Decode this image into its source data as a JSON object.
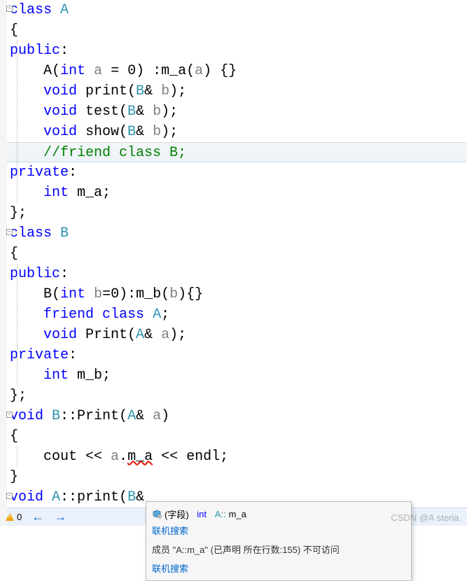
{
  "code": {
    "l1a": "class ",
    "l1b": "A",
    "l2": "{",
    "l3a": "public",
    "l3b": ":",
    "l4a": "    A(",
    "l4b": "int",
    "l4c": " ",
    "l4d": "a",
    "l4e": " = 0) :m_a(",
    "l4f": "a",
    "l4g": ") {}",
    "l5a": "    ",
    "l5b": "void",
    "l5c": " print(",
    "l5d": "B",
    "l5e": "& ",
    "l5f": "b",
    "l5g": ");",
    "l6a": "    ",
    "l6b": "void",
    "l6c": " test(",
    "l6d": "B",
    "l6e": "& ",
    "l6f": "b",
    "l6g": ");",
    "l7a": "    ",
    "l7b": "void",
    "l7c": " show(",
    "l7d": "B",
    "l7e": "& ",
    "l7f": "b",
    "l7g": ");",
    "l8": "    //friend class B;",
    "l9a": "private",
    "l9b": ":",
    "l10a": "    ",
    "l10b": "int",
    "l10c": " m_a;",
    "l11": "};",
    "l12a": "class ",
    "l12b": "B",
    "l13": "{",
    "l14a": "public",
    "l14b": ":",
    "l15a": "    B(",
    "l15b": "int",
    "l15c": " ",
    "l15d": "b",
    "l15e": "=0):m_b(",
    "l15f": "b",
    "l15g": "){}",
    "l16a": "    ",
    "l16b": "friend",
    "l16c": " ",
    "l16d": "class",
    "l16e": " ",
    "l16f": "A",
    "l16g": ";",
    "l17a": "    ",
    "l17b": "void",
    "l17c": " Print(",
    "l17d": "A",
    "l17e": "& ",
    "l17f": "a",
    "l17g": ");",
    "l18a": "private",
    "l18b": ":",
    "l19a": "    ",
    "l19b": "int",
    "l19c": " m_b;",
    "l20": "};",
    "l21a": "void",
    "l21b": " ",
    "l21c": "B",
    "l21d": "::Print(",
    "l21e": "A",
    "l21f": "& ",
    "l21g": "a",
    "l21h": ")",
    "l22": "{",
    "l23a": "    cout << ",
    "l23b": "a",
    "l23c": ".",
    "l23d": "m_a",
    "l23e": " << endl;",
    "l24": "}",
    "l25a": "void",
    "l25b": " ",
    "l25c": "A",
    "l25d": "::print(",
    "l25e": "B",
    "l25f": "&"
  },
  "tooltip": {
    "field_label": "(字段)",
    "sig_kw": "int",
    "sig_class": "A::",
    "sig_member": "m_a",
    "link1": "联机搜索",
    "message": "成员 \"A::m_a\" (已声明 所在行数:155) 不可访问",
    "link2": "联机搜索"
  },
  "statusbar": {
    "warning_count": "0"
  },
  "watermark": "CSDN @A steria."
}
